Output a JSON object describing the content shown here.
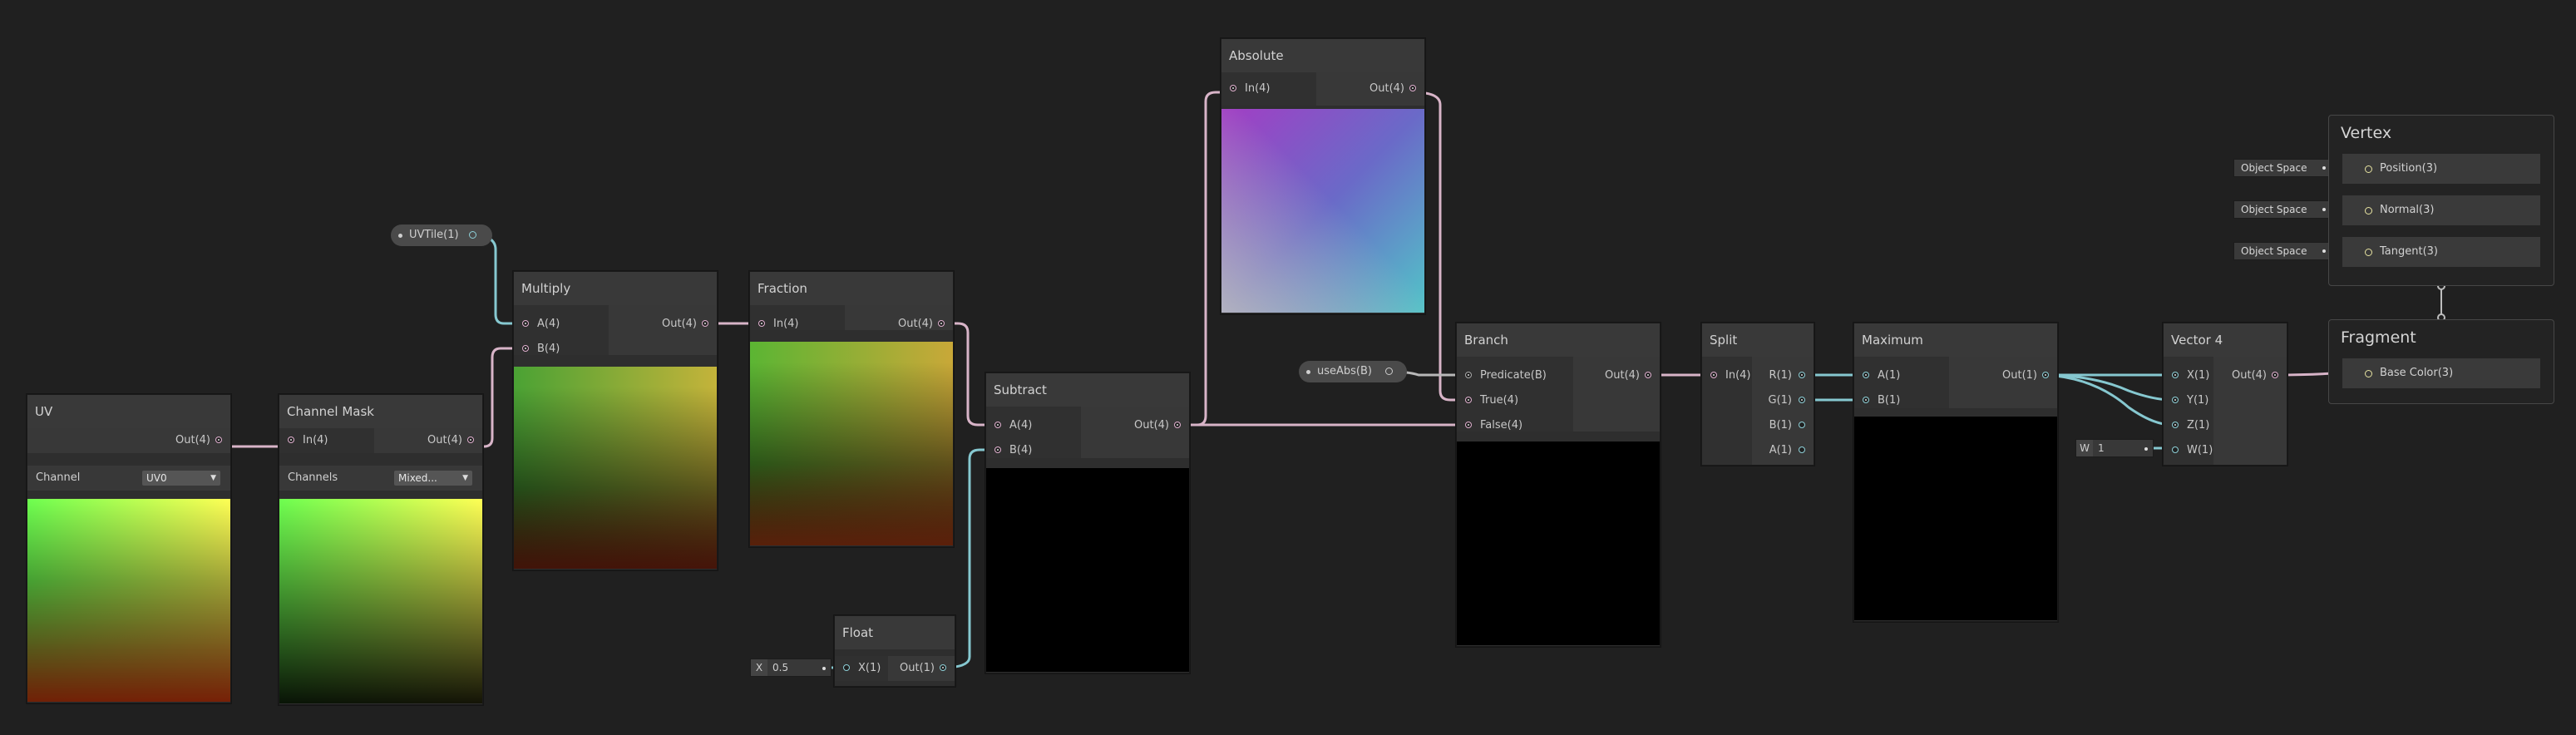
{
  "colors": {
    "background": "#202020",
    "wire_pink": "#d8b4c8",
    "wire_teal": "#86c8d0",
    "wire_yellow": "#e8e4a0",
    "wire_gray": "#b8b8b8"
  },
  "nodes": {
    "uv": {
      "title": "UV",
      "out": "Out(4)",
      "prop_label": "Channel",
      "prop_value": "UV0"
    },
    "channel_mask": {
      "title": "Channel Mask",
      "in": "In(4)",
      "out": "Out(4)",
      "prop_label": "Channels",
      "prop_value": "Mixed..."
    },
    "multiply": {
      "title": "Multiply",
      "in_a": "A(4)",
      "in_b": "B(4)",
      "out": "Out(4)"
    },
    "fraction": {
      "title": "Fraction",
      "in": "In(4)",
      "out": "Out(4)"
    },
    "subtract": {
      "title": "Subtract",
      "in_a": "A(4)",
      "in_b": "B(4)",
      "out": "Out(4)"
    },
    "float": {
      "title": "Float",
      "in": "X(1)",
      "out": "Out(1)",
      "field_label": "X",
      "field_value": "0.5"
    },
    "absolute": {
      "title": "Absolute",
      "in": "In(4)",
      "out": "Out(4)"
    },
    "branch": {
      "title": "Branch",
      "in_predicate": "Predicate(B)",
      "in_true": "True(4)",
      "in_false": "False(4)",
      "out": "Out(4)"
    },
    "split": {
      "title": "Split",
      "in": "In(4)",
      "out_r": "R(1)",
      "out_g": "G(1)",
      "out_b": "B(1)",
      "out_a": "A(1)"
    },
    "maximum": {
      "title": "Maximum",
      "in_a": "A(1)",
      "in_b": "B(1)",
      "out": "Out(1)"
    },
    "vector4": {
      "title": "Vector 4",
      "in_x": "X(1)",
      "in_y": "Y(1)",
      "in_z": "Z(1)",
      "in_w": "W(1)",
      "out": "Out(4)",
      "w_label": "W",
      "w_value": "1"
    }
  },
  "properties": {
    "uvtile": {
      "label": "UVTile(1)"
    },
    "useabs": {
      "label": "useAbs(B)"
    }
  },
  "master": {
    "vertex": {
      "title": "Vertex",
      "slots": [
        "Position(3)",
        "Normal(3)",
        "Tangent(3)"
      ],
      "space": "Object Space"
    },
    "fragment": {
      "title": "Fragment",
      "slots": [
        "Base Color(3)"
      ]
    }
  }
}
